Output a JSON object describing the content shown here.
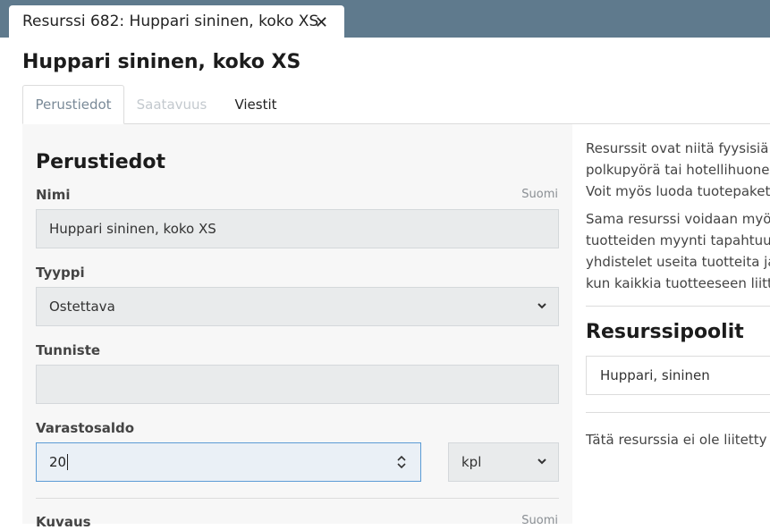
{
  "window_tab": {
    "title": "Resurssi 682: Huppari sininen, koko XS",
    "close_symbol": "✕"
  },
  "page_title": "Huppari sininen, koko XS",
  "subtabs": [
    {
      "label": "Perustiedot",
      "state": "active"
    },
    {
      "label": "Saatavuus",
      "state": "disabled"
    },
    {
      "label": "Viestit",
      "state": "normal"
    }
  ],
  "form": {
    "section_title": "Perustiedot",
    "name_label": "Nimi",
    "name_lang": "Suomi",
    "name_value": "Huppari sininen, koko XS",
    "type_label": "Tyyppi",
    "type_value": "Ostettava",
    "identifier_label": "Tunniste",
    "identifier_value": "",
    "stock_label": "Varastosaldo",
    "stock_value": "20",
    "unit_value": "kpl",
    "description_label": "Kuvaus",
    "description_lang": "Suomi"
  },
  "sidebar": {
    "para1": [
      "Resurssit ovat niitä fyysisiä a",
      "polkupyörä tai hotellihuone.",
      "Voit myös luoda tuotepakett"
    ],
    "para2": [
      "Sama resurssi voidaan myös",
      "tuotteiden myynti tapahtuu k",
      "yhdistelet useita tuotteita ja",
      "kun kaikkia tuotteeseen liitty"
    ],
    "pools_title": "Resurssipoolit",
    "pool_item": "Huppari, sininen",
    "not_linked_text": "Tätä resurssia ei ole liitetty s"
  },
  "colors": {
    "topbar": "#5f7a8d",
    "focus_border": "#5b9bd5",
    "field_bg": "#e9ebec"
  }
}
